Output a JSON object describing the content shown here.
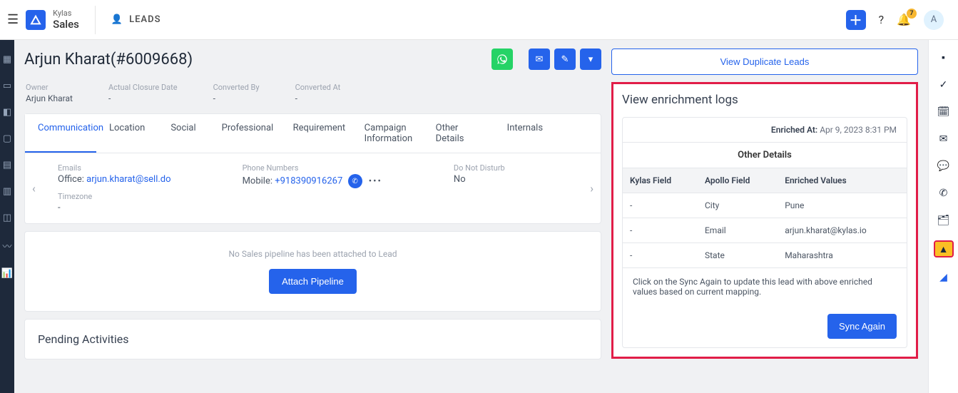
{
  "brand": {
    "line1": "Kylas",
    "line2": "Sales"
  },
  "module": "LEADS",
  "notif_count": "7",
  "avatar_initial": "A",
  "lead": {
    "name": "Arjun Kharat",
    "id": "#6009668",
    "title": "Arjun Kharat(#6009668)"
  },
  "meta": {
    "owner_label": "Owner",
    "owner_value": "Arjun Kharat",
    "closure_label": "Actual Closure Date",
    "closure_value": "-",
    "convby_label": "Converted By",
    "convby_value": "-",
    "convat_label": "Converted At",
    "convat_value": "-"
  },
  "tabs": [
    "Communication",
    "Location",
    "Social",
    "Professional",
    "Requirement",
    "Campaign Information",
    "Other Details",
    "Internals"
  ],
  "comm": {
    "emails_label": "Emails",
    "office_label": "Office: ",
    "office_value": "arjun.kharat@sell.do",
    "timezone_label": "Timezone",
    "timezone_value": "-",
    "phone_label": "Phone Numbers",
    "mobile_label": "Mobile: ",
    "mobile_value": "+918390916267",
    "dnd_label": "Do Not Disturb",
    "dnd_value": "No"
  },
  "pipeline": {
    "msg": "No Sales pipeline has been attached to Lead",
    "btn": "Attach Pipeline"
  },
  "pending_title": "Pending Activities",
  "side": {
    "dup_label": "View Duplicate Leads",
    "enrich_title": "View enrichment logs",
    "enriched_at_label": "Enriched At:",
    "enriched_at_value": "Apr 9, 2023 8:31 PM",
    "table_caption": "Other Details",
    "th1": "Kylas Field",
    "th2": "Apollo Field",
    "th3": "Enriched Values",
    "rows": [
      {
        "k": "-",
        "a": "City",
        "v": "Pune"
      },
      {
        "k": "-",
        "a": "Email",
        "v": "arjun.kharat@kylas.io"
      },
      {
        "k": "-",
        "a": "State",
        "v": "Maharashtra"
      }
    ],
    "hint": "Click on the Sync Again to update this lead with above enriched values based on current mapping.",
    "sync_btn": "Sync Again"
  }
}
